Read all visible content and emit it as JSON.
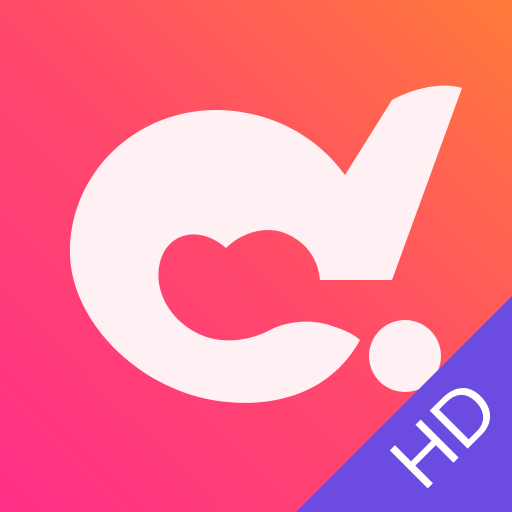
{
  "icon": {
    "name": "app-logo-icon",
    "badge_label": "HD",
    "colors": {
      "gradient_start": "#ff2f87",
      "gradient_mid": "#ff4a6a",
      "gradient_end": "#ff7a3a",
      "mark": "#fff1f3",
      "badge": "#6b4be0",
      "badge_text": "#ffffff"
    }
  }
}
